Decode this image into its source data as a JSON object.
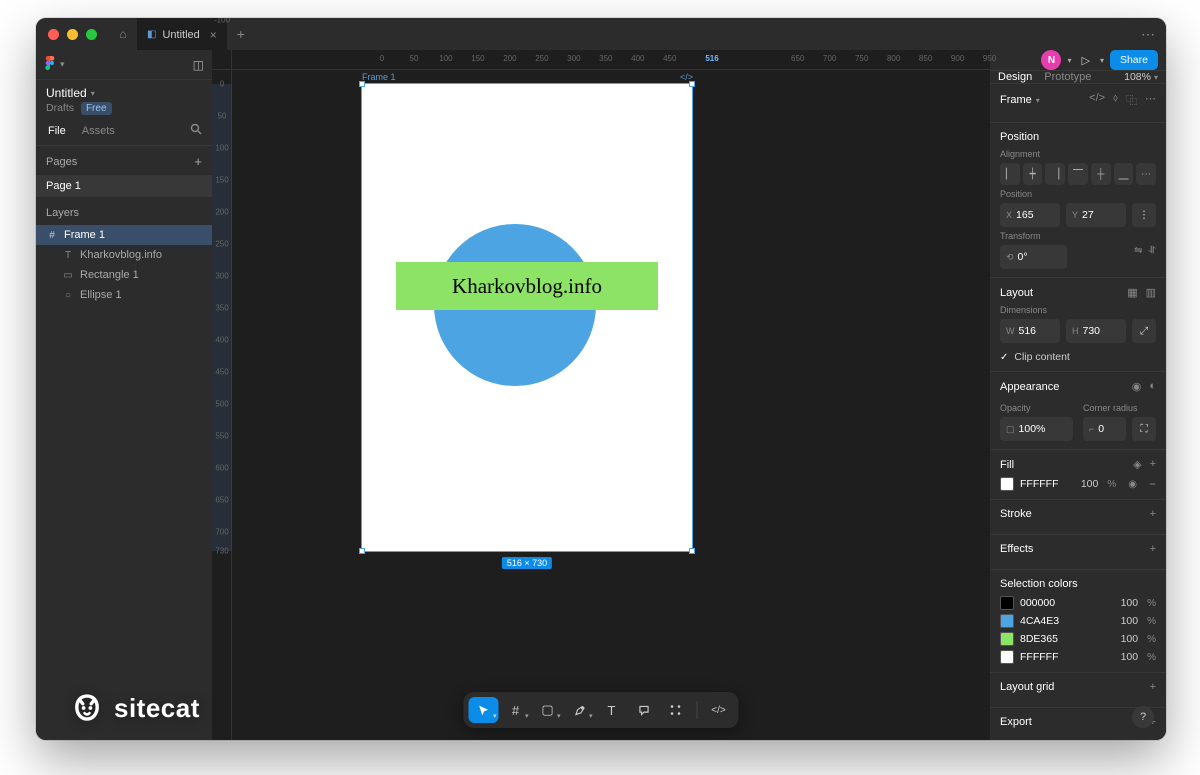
{
  "titlebar": {
    "tab": "Untitled"
  },
  "left": {
    "project": "Untitled",
    "crumb_drafts": "Drafts",
    "badge_free": "Free",
    "tabs": {
      "file": "File",
      "assets": "Assets"
    },
    "pages_label": "Pages",
    "page1": "Page 1",
    "layers_label": "Layers",
    "layers": {
      "frame": "Frame 1",
      "text": "Kharkovblog.info",
      "rect": "Rectangle 1",
      "ellipse": "Ellipse 1"
    }
  },
  "canvas": {
    "frame_label": "Frame 1",
    "text_content": "Kharkovblog.info",
    "dims_badge": "516 × 730",
    "ruler_h": [
      "0",
      "50",
      "100",
      "150",
      "200",
      "250",
      "300",
      "350",
      "400",
      "450",
      "516",
      "650",
      "700",
      "750",
      "800",
      "850",
      "900",
      "950"
    ],
    "ruler_h_hl_index": 10,
    "ruler_v": [
      "-100",
      "0",
      "50",
      "100",
      "150",
      "200",
      "250",
      "300",
      "350",
      "400",
      "450",
      "500",
      "550",
      "600",
      "650",
      "700",
      "730"
    ],
    "ruler_v_hl_index": 16,
    "ruler_v_from": "0",
    "ruler_v_to": "730"
  },
  "toolbar": {
    "tools": [
      "move",
      "frame",
      "rect",
      "pen",
      "text",
      "comment",
      "actions",
      "dev"
    ]
  },
  "right": {
    "avatar": "N",
    "share": "Share",
    "tabs": {
      "design": "Design",
      "prototype": "Prototype"
    },
    "zoom": "108%",
    "frame_title": "Frame",
    "position": {
      "section": "Position",
      "alignment_label": "Alignment",
      "pos_label": "Position",
      "x": "165",
      "y": "27",
      "transform_label": "Transform",
      "rotation": "0°"
    },
    "layout": {
      "title": "Layout",
      "dimensions_label": "Dimensions",
      "w": "516",
      "h": "730",
      "clip": "Clip content"
    },
    "appearance": {
      "title": "Appearance",
      "opacity_label": "Opacity",
      "opacity": "100%",
      "radius_label": "Corner radius",
      "radius": "0"
    },
    "fill": {
      "title": "Fill",
      "hex": "FFFFFF",
      "pct": "100"
    },
    "stroke": {
      "title": "Stroke"
    },
    "effects": {
      "title": "Effects"
    },
    "selcolors": {
      "title": "Selection colors",
      "items": [
        {
          "hex": "000000",
          "pct": "100",
          "swatch": "#000000"
        },
        {
          "hex": "4CA4E3",
          "pct": "100",
          "swatch": "#4ca4e3"
        },
        {
          "hex": "8DE365",
          "pct": "100",
          "swatch": "#8de365"
        },
        {
          "hex": "FFFFFF",
          "pct": "100",
          "swatch": "#ffffff"
        }
      ]
    },
    "layoutgrid": "Layout grid",
    "export": "Export"
  },
  "watermark": "sitecat"
}
